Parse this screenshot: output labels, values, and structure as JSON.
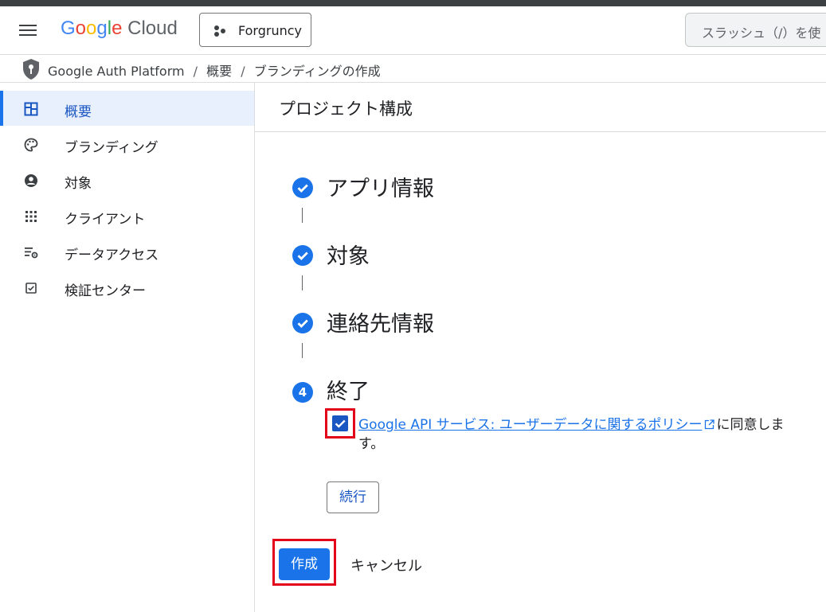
{
  "header": {
    "logo_google": [
      "G",
      "o",
      "o",
      "g",
      "l",
      "e"
    ],
    "logo_google_colors": [
      "#4285f4",
      "#ea4335",
      "#fbbc04",
      "#4285f4",
      "#34a853",
      "#ea4335"
    ],
    "logo_cloud": "Cloud",
    "project_name": "Forgruncy",
    "search_placeholder": "スラッシュ（/）を使"
  },
  "breadcrumb": {
    "items": [
      "Google Auth Platform",
      "概要",
      "ブランディングの作成"
    ],
    "separator": "/"
  },
  "sidebar": {
    "items": [
      {
        "label": "概要",
        "icon": "dashboard-icon",
        "active": true
      },
      {
        "label": "ブランディング",
        "icon": "palette-icon",
        "active": false
      },
      {
        "label": "対象",
        "icon": "person-circle-icon",
        "active": false
      },
      {
        "label": "クライアント",
        "icon": "apps-grid-icon",
        "active": false
      },
      {
        "label": "データアクセス",
        "icon": "data-settings-icon",
        "active": false
      },
      {
        "label": "検証センター",
        "icon": "checkbox-icon",
        "active": false
      }
    ]
  },
  "main": {
    "title": "プロジェクト構成",
    "steps": [
      {
        "label": "アプリ情報",
        "status": "done"
      },
      {
        "label": "対象",
        "status": "done"
      },
      {
        "label": "連絡先情報",
        "status": "done"
      },
      {
        "label": "終了",
        "status": "current",
        "number": "4"
      }
    ],
    "consent": {
      "checked": true,
      "link_text": "Google API サービス: ユーザーデータに関するポリシー",
      "suffix": "に同意します。"
    },
    "continue_label": "続行",
    "create_label": "作成",
    "cancel_label": "キャンセル"
  },
  "colors": {
    "accent": "#1a73e8",
    "highlight": "#e3001b"
  }
}
